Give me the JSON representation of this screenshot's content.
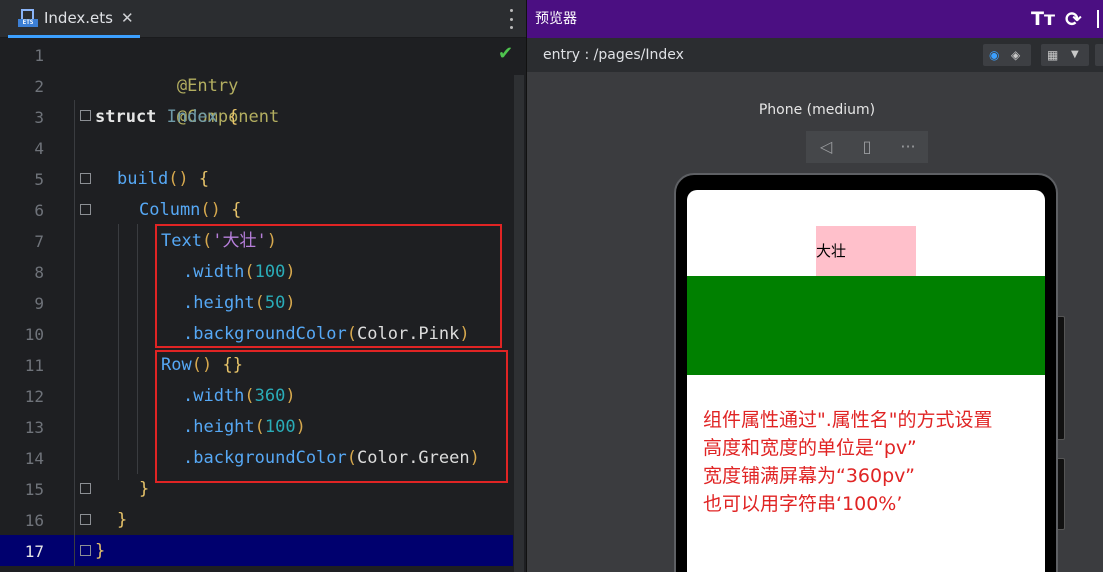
{
  "editor": {
    "tab_label": "Index.ets",
    "tab_close": "✕",
    "tab_badge": "ETS",
    "active_line": 17,
    "line_numbers": [
      "1",
      "2",
      "3",
      "4",
      "5",
      "6",
      "7",
      "8",
      "9",
      "10",
      "11",
      "12",
      "13",
      "14",
      "15",
      "16",
      "17"
    ],
    "code": {
      "l1": "@Entry",
      "l2": "@Component",
      "l3_kw": "struct",
      "l3_name": "Index",
      "l3_brace": "{",
      "l5_fn": "build",
      "l5_paren": "()",
      "l5_brace": "{",
      "l6_fn": "Column",
      "l6_paren": "()",
      "l6_brace": "{",
      "l7_fn": "Text",
      "l7_open": "(",
      "l7_str": "'大壮'",
      "l7_close": ")",
      "l8_prop": ".width",
      "l8_open": "(",
      "l8_num": "100",
      "l8_close": ")",
      "l9_prop": ".height",
      "l9_open": "(",
      "l9_num": "50",
      "l9_close": ")",
      "l10_prop": ".backgroundColor",
      "l10_open": "(",
      "l10_val": "Color.Pink",
      "l10_close": ")",
      "l11_fn": "Row",
      "l11_paren": "()",
      "l11_brace": "{}",
      "l12_prop": ".width",
      "l12_open": "(",
      "l12_num": "360",
      "l12_close": ")",
      "l13_prop": ".height",
      "l13_open": "(",
      "l13_num": "100",
      "l13_close": ")",
      "l14_prop": ".backgroundColor",
      "l14_open": "(",
      "l14_val": "Color.Green",
      "l14_close": ")",
      "l15": "}",
      "l16": "}",
      "l17": "}"
    },
    "status_icon": "checkmark-icon",
    "status_glyph": "✔"
  },
  "preview": {
    "title": "预览器",
    "font_toggle": "Tт",
    "refresh_glyph": "⟳",
    "route": "entry : /pages/Index",
    "device_name": "Phone (medium)",
    "ctrl_back": "◁",
    "ctrl_rotate": "▯",
    "ctrl_more": "···",
    "text_component": "大壮",
    "note_lines": [
      "组件属性通过\".属性名\"的方式设置",
      "高度和宽度的单位是“pv”",
      "宽度铺满屏幕为“360pv”",
      "也可以用字符串‘100%’"
    ]
  },
  "colors": {
    "accent_tab": "#3ca0ff",
    "preview_title_bg": "#4b0f82",
    "pink": "#ffc0cb",
    "green": "#008000",
    "annotation_red": "#e02424",
    "active_line_bg": "#00006e"
  }
}
